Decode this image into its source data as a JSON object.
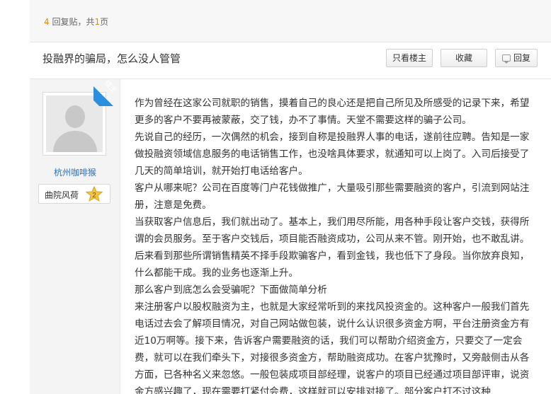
{
  "header": {
    "reply_count": "4",
    "reply_label": "回复贴，共",
    "page_count": "1",
    "page_label": "页"
  },
  "thread": {
    "title": "投融界的骗局，怎么没人管管",
    "buttons": {
      "owner_only": "只看楼主",
      "favorite": "收藏",
      "reply": "回复"
    }
  },
  "author": {
    "owner_tag": "楼主",
    "username": "杭州咖啡猴",
    "level_name": "曲院风荷",
    "level": "2"
  },
  "post": {
    "paragraphs": [
      "作为曾经在这家公司就职的销售，摸着自己的良心还是把自己所见及所感受的记录下来，希望更多的客户不要再被蒙蔽，交了钱，办不了事情。天堂不需要这样的骗子公司。",
      "先说自己的经历，一次偶然的机会，接到自称是投融界人事的电话，遂前往应聘。告知是一家做投融资领域信息服务的电话销售工作，也没啥具体要求，就通知可以上岗了。入司后接受了几天的简单培训，就开始打电话给客户。",
      "客户从哪来呢？公司在百度等门户花钱做推广，大量吸引那些需要融资的客户，引流到网站注册，注意是免费。",
      "当获取客户信息后，我们就出动了。基本上，我们用尽所能，用各种手段让客户交钱，获得所谓的会员服务。至于客户交钱后，项目能否融资成功，公司从来不管。刚开始，也不敢乱讲。后来看到那些所谓销售精英不择手段欺骗客户，看到金钱，我也低下了身段。当你放弃良知，什么都能干成。我的业务也逐渐上升。",
      "那么客户到底怎么会受骗呢？下面做简单分析",
      "来注册客户以股权融资为主，也就是大家经常听到的来找风投资金的。这种客户一般我们首先电话过去会了解项目情况，对自己网站做包装，说什么认识很多资金方啊，平台注册资金方有近10万啊等。接下来，告诉客户需要融资的话，我们可以帮助介绍资金方，只要交了一定会费，就可以在我们牵头下，对接很多资金方，帮助融资成功。在客户犹豫时，又旁敲侧击从各方面，已各种名义来忽悠。一般包装成项目部经理，说客户的项目已经通过项目部评审，说资金方感兴趣了，现在需要打紧付会费，这样就可以安排对接了。部分客户打不过这种"
    ]
  }
}
